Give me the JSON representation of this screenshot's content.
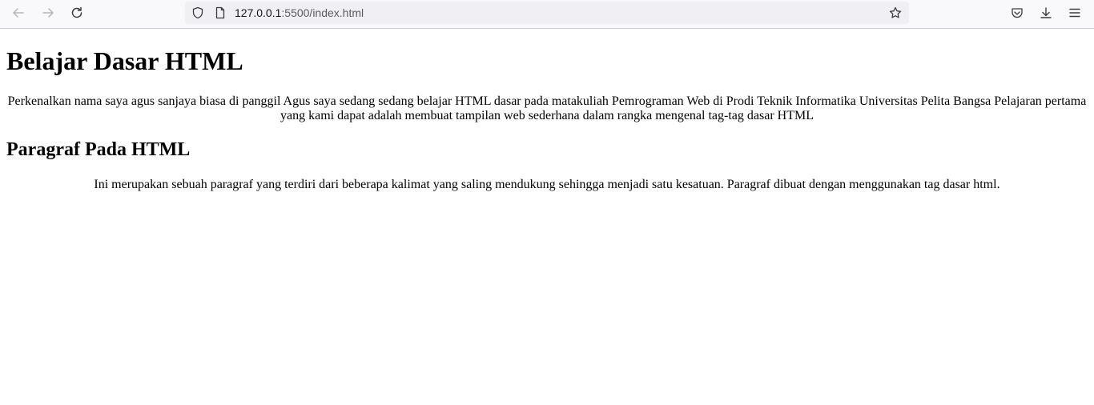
{
  "browser": {
    "url_host": "127.0.0.1",
    "url_rest": ":5500/index.html",
    "icons": {
      "back": "back-arrow-icon",
      "forward": "forward-arrow-icon",
      "reload": "reload-icon",
      "shield": "tracking-protection-shield-icon",
      "page": "page-info-icon",
      "bookmark": "bookmark-star-icon",
      "pocket": "pocket-icon",
      "downloads": "download-icon",
      "menu": "hamburger-menu-icon"
    }
  },
  "page": {
    "heading": "Belajar Dasar HTML",
    "intro": "Perkenalkan nama saya agus sanjaya biasa di panggil Agus saya sedang sedang belajar HTML dasar pada matakuliah Pemrograman Web di Prodi Teknik Informatika Universitas Pelita Bangsa Pelajaran pertama yang kami dapat adalah membuat tampilan web sederhana dalam rangka mengenal tag-tag dasar HTML",
    "subheading": "Paragraf Pada HTML",
    "paragraph": "Ini merupakan sebuah paragraf yang terdiri dari beberapa kalimat yang saling mendukung sehingga menjadi satu kesatuan. Paragraf dibuat dengan menggunakan tag dasar html."
  }
}
